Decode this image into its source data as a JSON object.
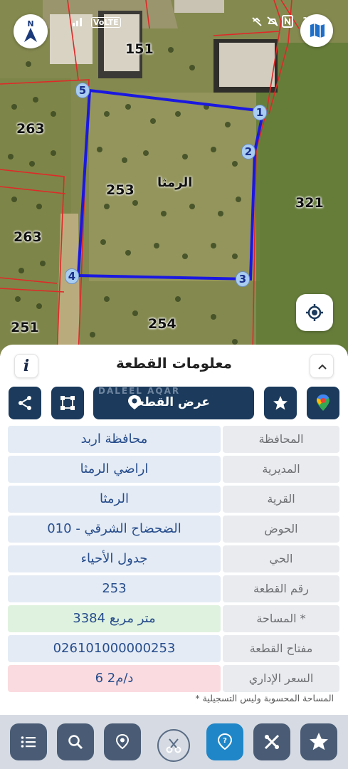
{
  "status_bar": {
    "carrier_label": "VoLTE",
    "battery": "1"
  },
  "map": {
    "parcels": {
      "p151": "151",
      "p263a": "263",
      "p263b": "263",
      "p253": "253",
      "p321": "321",
      "p251": "251",
      "p254": "254"
    },
    "village_name": "الرمثا",
    "vertices": [
      "1",
      "2",
      "3",
      "4",
      "5"
    ],
    "colors": {
      "parcel_outline": "#1a18e0",
      "cadastre_lines": "#e02828"
    }
  },
  "panel": {
    "title": "معلومات القطعة",
    "info_button": "i",
    "actions": {
      "show_parcel": "عرض القطعة",
      "watermark": "DALEEL AQAR"
    },
    "rows": [
      {
        "key": "المحافظة",
        "value": "محافظة اربد"
      },
      {
        "key": "المديرية",
        "value": "اراضي الرمثا"
      },
      {
        "key": "القرية",
        "value": "الرمثا"
      },
      {
        "key": "الحوض",
        "value": "الضحضاح الشرقي - 010"
      },
      {
        "key": "الحي",
        "value": "جدول الأحياء"
      },
      {
        "key": "رقم القطعة",
        "value": "253"
      },
      {
        "key": "المساحة *",
        "value": "3384  متر مربع"
      },
      {
        "key": "مفتاح القطعة",
        "value": "026101000000253"
      },
      {
        "key": "السعر الإداري",
        "value": "6 د/م2"
      }
    ],
    "footnote": "* المساحة المحسوبة وليس التسجيلية"
  },
  "bottom_nav": {
    "items": [
      "list-icon",
      "search-icon",
      "location-pin-icon",
      "scissors-icon",
      "help-pin-icon",
      "tools-icon",
      "star-icon"
    ],
    "accent": "#1f86c8"
  }
}
